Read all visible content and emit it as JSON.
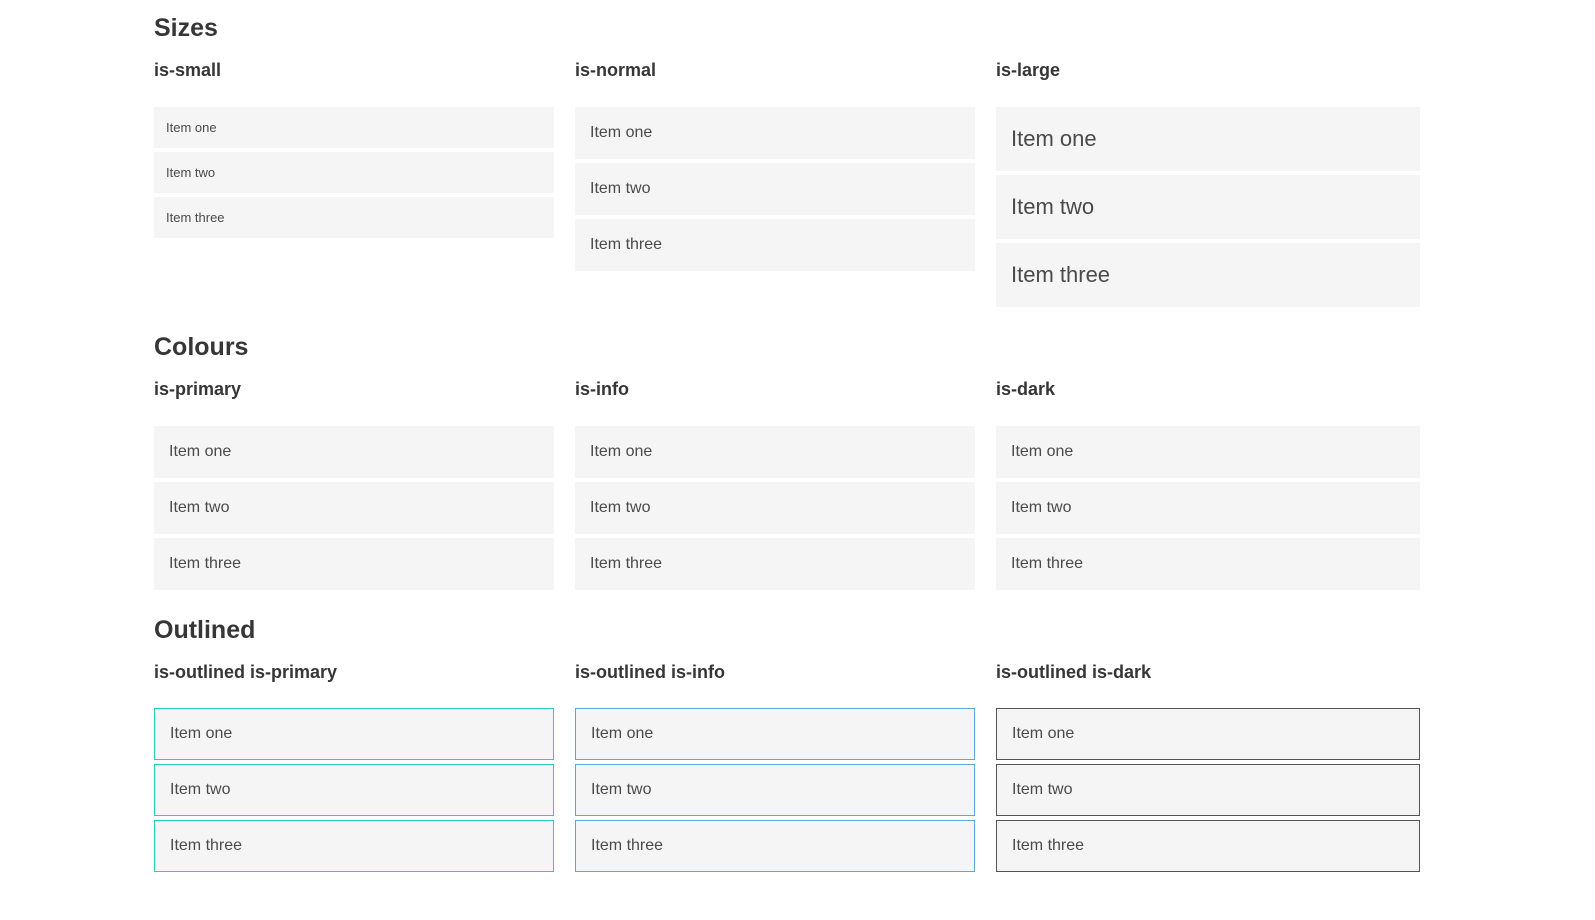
{
  "colors": {
    "primary": "#0bcfb2",
    "info": "#3596db",
    "dark": "#363636",
    "item_light_bg": "#f5f5f5",
    "item_text": "#4a4a4a",
    "heading_text": "#363636",
    "outlined_primary_border": "#2bd0b3",
    "outlined_info_border": "#5aa7de",
    "outlined_dark_border": "#555555",
    "white": "#ffffff"
  },
  "sections": [
    {
      "title": "Sizes",
      "groups": [
        {
          "label": "is-small",
          "items": [
            "Item one",
            "Item two",
            "Item three"
          ]
        },
        {
          "label": "is-normal",
          "items": [
            "Item one",
            "Item two",
            "Item three"
          ]
        },
        {
          "label": "is-large",
          "items": [
            "Item one",
            "Item two",
            "Item three"
          ]
        }
      ]
    },
    {
      "title": "Colours",
      "groups": [
        {
          "label": "is-primary",
          "items": [
            "Item one",
            "Item two",
            "Item three"
          ]
        },
        {
          "label": "is-info",
          "items": [
            "Item one",
            "Item two",
            "Item three"
          ]
        },
        {
          "label": "is-dark",
          "items": [
            "Item one",
            "Item two",
            "Item three"
          ]
        }
      ]
    },
    {
      "title": "Outlined",
      "groups": [
        {
          "label": "is-outlined is-primary",
          "items": [
            "Item one",
            "Item two",
            "Item three"
          ]
        },
        {
          "label": "is-outlined is-info",
          "items": [
            "Item one",
            "Item two",
            "Item three"
          ]
        },
        {
          "label": "is-outlined is-dark",
          "items": [
            "Item one",
            "Item two",
            "Item three"
          ]
        }
      ]
    }
  ]
}
